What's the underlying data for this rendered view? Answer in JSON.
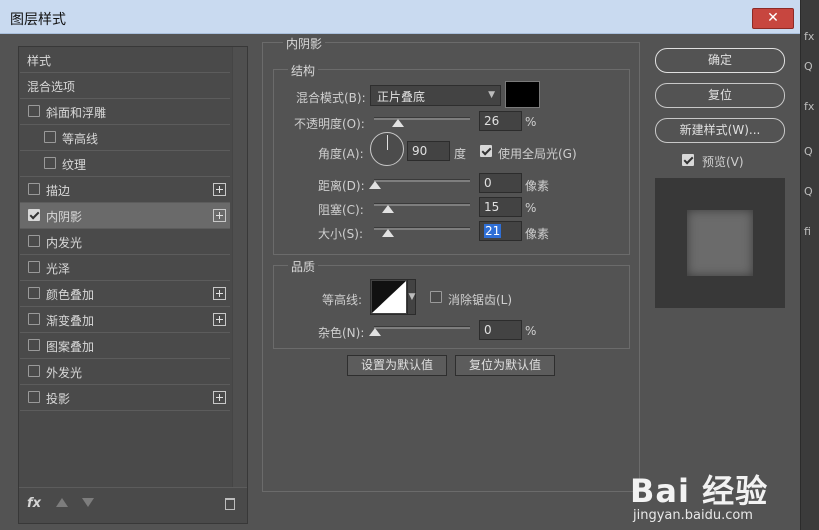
{
  "window": {
    "title": "图层样式",
    "close_glyph": "✕"
  },
  "left_list": {
    "items": [
      {
        "label": "样式",
        "has_checkbox": false,
        "checked": false,
        "has_plus": false,
        "selected": false
      },
      {
        "label": "混合选项",
        "has_checkbox": false,
        "checked": false,
        "has_plus": false,
        "selected": false
      },
      {
        "label": "斜面和浮雕",
        "has_checkbox": true,
        "checked": false,
        "has_plus": false,
        "selected": false
      },
      {
        "label": "等高线",
        "has_checkbox": true,
        "checked": false,
        "has_plus": false,
        "selected": false
      },
      {
        "label": "纹理",
        "has_checkbox": true,
        "checked": false,
        "has_plus": false,
        "selected": false
      },
      {
        "label": "描边",
        "has_checkbox": true,
        "checked": false,
        "has_plus": true,
        "selected": false
      },
      {
        "label": "内阴影",
        "has_checkbox": true,
        "checked": true,
        "has_plus": true,
        "selected": true
      },
      {
        "label": "内发光",
        "has_checkbox": true,
        "checked": false,
        "has_plus": false,
        "selected": false
      },
      {
        "label": "光泽",
        "has_checkbox": true,
        "checked": false,
        "has_plus": false,
        "selected": false
      },
      {
        "label": "颜色叠加",
        "has_checkbox": true,
        "checked": false,
        "has_plus": true,
        "selected": false
      },
      {
        "label": "渐变叠加",
        "has_checkbox": true,
        "checked": false,
        "has_plus": true,
        "selected": false
      },
      {
        "label": "图案叠加",
        "has_checkbox": true,
        "checked": false,
        "has_plus": false,
        "selected": false
      },
      {
        "label": "外发光",
        "has_checkbox": true,
        "checked": false,
        "has_plus": false,
        "selected": false
      },
      {
        "label": "投影",
        "has_checkbox": true,
        "checked": false,
        "has_plus": true,
        "selected": false
      }
    ],
    "footer": {
      "fx_label": "fx"
    }
  },
  "inner_shadow": {
    "title": "内阴影",
    "structure": {
      "title": "结构",
      "blend_mode_label": "混合模式(B):",
      "blend_mode_value": "正片叠底",
      "shadow_color": "#000000",
      "opacity_label": "不透明度(O):",
      "opacity_value": "26",
      "opacity_unit": "%",
      "angle_label": "角度(A):",
      "angle_value": "90",
      "angle_unit": "度",
      "use_global_light_label": "使用全局光(G)",
      "use_global_light_checked": true,
      "distance_label": "距离(D):",
      "distance_value": "0",
      "distance_unit": "像素",
      "choke_label": "阻塞(C):",
      "choke_value": "15",
      "choke_unit": "%",
      "size_label": "大小(S):",
      "size_value": "21",
      "size_unit": "像素"
    },
    "quality": {
      "title": "品质",
      "contour_label": "等高线:",
      "anti_aliased_label": "消除锯齿(L)",
      "anti_aliased_checked": false,
      "noise_label": "杂色(N):",
      "noise_value": "0",
      "noise_unit": "%"
    },
    "buttons": {
      "make_default": "设置为默认值",
      "reset_to_default": "复位为默认值"
    }
  },
  "right_buttons": {
    "ok": "确定",
    "reset": "复位",
    "new_style": "新建样式(W)...",
    "preview_label": "预览(V)",
    "preview_checked": true
  },
  "watermark": {
    "logo": "Bai 经验",
    "url": "jingyan.baidu.com"
  },
  "edge_strip": {
    "glyphs": [
      "fx",
      "Q",
      "fx",
      "Q",
      "Q",
      "fi"
    ]
  },
  "colors": {
    "panel_bg": "#535353",
    "title_bar": "#c9daf0",
    "close_button": "#c7463f",
    "focus_blue": "#2f6fd6"
  }
}
